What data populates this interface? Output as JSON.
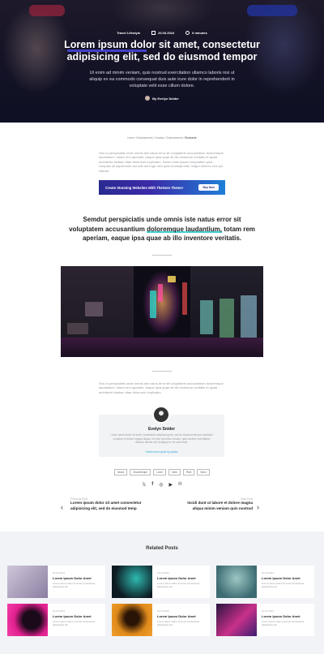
{
  "hero": {
    "category": "Travel Lifestyle",
    "date": "20.03.2024",
    "read_time": "6 minutes",
    "title": "Lorem ipsum dolor sit amet, consectetur adipisicing elit, sed do eiusmod tempor",
    "subtitle": "Ut enim ad minim veniam, quis nostrud exercitation ullamco laboris nisi ut aliquip ex ea commodo consequat duis aute irure dolor in reprehenderit in voluptate velit esse cillum dolore.",
    "author": "By Evelyn Snider"
  },
  "breadcrumb": {
    "home": "Home",
    "sep1": "/",
    "section": "Entertainment / Creative",
    "sep2": "/",
    "sub": "Entertainment",
    "sep3": "/",
    "current": "Ristorante"
  },
  "intro_paragraph": "Sed ut perspiciatis unde omnis iste natus error sit voluptatem accusantium doloremque laudantium, totam rem aperiam, eaque ipsa quae ab illo inventore veritatis et quasi architecto beatae vitae dicta sunt explicabo. Nemo enim ipsam voluptatem quia voluptas sit aspernatur aut odit aut fugit, sed quia consequuntur magni dolores eos qui ratione.",
  "banner": {
    "text": "Create Stunning Websites With TheGem Theme!",
    "button": "Buy Now"
  },
  "quote": {
    "before": "Semdut perspiciatis unde omnis iste natus error sit voluptatem accusantium ",
    "highlight": "doloremque laudantium,",
    "after": " totam rem aperiam, eaque ipsa quae ab illo inventore veritatis."
  },
  "second_paragraph": "Sed ut perspiciatis unde omnis iste natus error sit voluptatem accusantium doloremque laudantium, totam rem aperiam, eaque ipsa quae ab illo inventore veritatis et quasi architecto beatae vitae dicta sunt explicabo.",
  "author_card": {
    "name": "Evelyn Snider",
    "bio": "Lorem ipsum dolor sit amet, consectetur adipisicing elit, sed do eiusmod tempor incididunt ut labore et dolore magna aliqua. Ut enim ad minim veniam, quis nostrud exercitation ullamco laboris nisi ut aliquip ex ea commodo.",
    "link": "Check more posts by author"
  },
  "tags": [
    "Music",
    "Discotheque",
    "Lover",
    "Dark",
    "Ride",
    "Neon"
  ],
  "social": [
    "twitter-icon",
    "facebook-icon",
    "instagram-icon",
    "youtube-icon",
    "pinterest-icon"
  ],
  "post_nav": {
    "prev_label": "Previous Post",
    "prev_title": "Lorem ipsum dolor sit amet consectetur adipisicing elit, sed do eiusmod temp",
    "next_label": "Next Post",
    "next_title": "Incidi dunt ut labore et dolore magna aliqua minim veniam quis nostrud"
  },
  "related": {
    "heading": "Related Posts",
    "posts": [
      {
        "date": "20.03.2024",
        "title": "Lorem Ipsum Dolor Amet",
        "excerpt": "Lorem ipsum dolor sit amet consectetur adipisicing elit"
      },
      {
        "date": "20.03.2024",
        "title": "Lorem Ipsum Dolor Amet",
        "excerpt": "Lorem ipsum dolor sit amet consectetur adipisicing elit"
      },
      {
        "date": "20.03.2024",
        "title": "Lorem Ipsum Dolor Amet",
        "excerpt": "Lorem ipsum dolor sit amet consectetur adipisicing elit"
      },
      {
        "date": "20.03.2024",
        "title": "Lorem Ipsum Dolor Amet",
        "excerpt": "Lorem ipsum dolor sit amet consectetur adipisicing elit"
      },
      {
        "date": "20.03.2024",
        "title": "Lorem Ipsum Dolor Amet",
        "excerpt": "Lorem ipsum dolor sit amet consectetur adipisicing elit"
      },
      {
        "date": "20.03.2024",
        "title": "Lorem Ipsum Dolor Amet",
        "excerpt": "Lorem ipsum dolor sit amet consectetur adipisicing elit"
      }
    ]
  },
  "colors": {
    "accent": "#3fd1d1",
    "link": "#2aa8d6",
    "hero_highlight": "#4b4cf0"
  }
}
